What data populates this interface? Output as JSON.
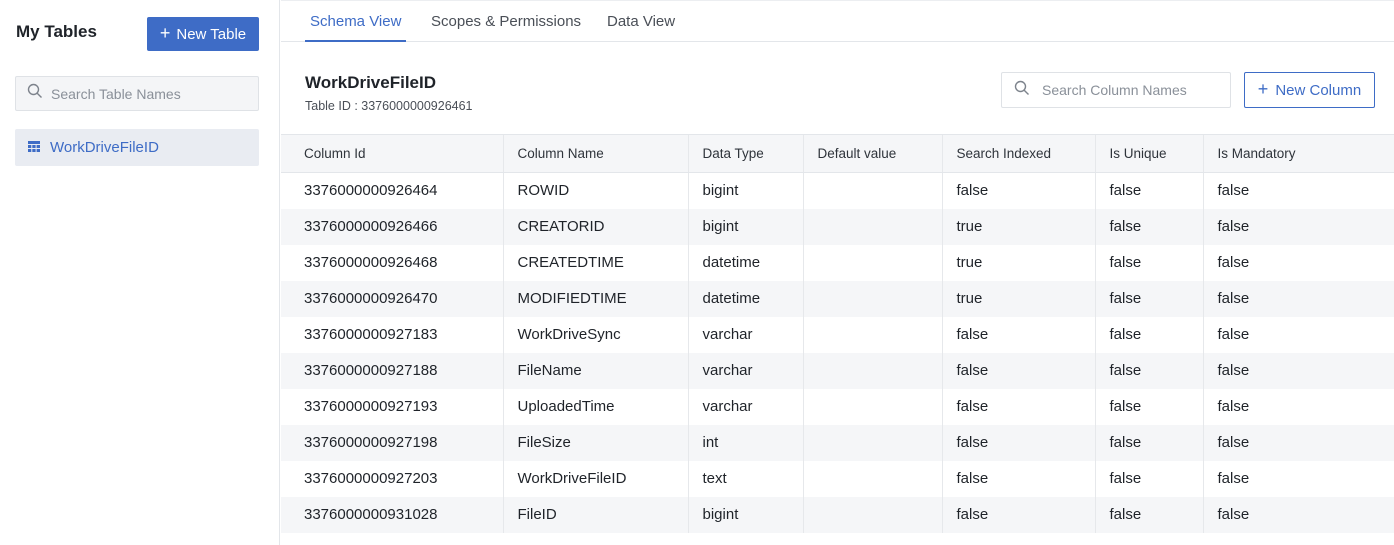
{
  "sidebar": {
    "title": "My Tables",
    "new_table_label": "New Table",
    "search_placeholder": "Search Table Names",
    "items": [
      {
        "label": "WorkDriveFileID",
        "selected": true
      }
    ]
  },
  "tabs": [
    {
      "label": "Schema View",
      "active": true
    },
    {
      "label": "Scopes & Permissions",
      "active": false
    },
    {
      "label": "Data View",
      "active": false
    }
  ],
  "table_header": {
    "name": "WorkDriveFileID",
    "id_text": "Table ID : 3376000000926461",
    "search_placeholder": "Search Column Names",
    "new_column_label": "New Column"
  },
  "columns": [
    "Column Id",
    "Column Name",
    "Data Type",
    "Default value",
    "Search Indexed",
    "Is Unique",
    "Is Mandatory"
  ],
  "rows": [
    [
      "3376000000926464",
      "ROWID",
      "bigint",
      "",
      "false",
      "false",
      "false"
    ],
    [
      "3376000000926466",
      "CREATORID",
      "bigint",
      "",
      "true",
      "false",
      "false"
    ],
    [
      "3376000000926468",
      "CREATEDTIME",
      "datetime",
      "",
      "true",
      "false",
      "false"
    ],
    [
      "3376000000926470",
      "MODIFIEDTIME",
      "datetime",
      "",
      "true",
      "false",
      "false"
    ],
    [
      "3376000000927183",
      "WorkDriveSync",
      "varchar",
      "",
      "false",
      "false",
      "false"
    ],
    [
      "3376000000927188",
      "FileName",
      "varchar",
      "",
      "false",
      "false",
      "false"
    ],
    [
      "3376000000927193",
      "UploadedTime",
      "varchar",
      "",
      "false",
      "false",
      "false"
    ],
    [
      "3376000000927198",
      "FileSize",
      "int",
      "",
      "false",
      "false",
      "false"
    ],
    [
      "3376000000927203",
      "WorkDriveFileID",
      "text",
      "",
      "false",
      "false",
      "false"
    ],
    [
      "3376000000931028",
      "FileID",
      "bigint",
      "",
      "false",
      "false",
      "false"
    ]
  ],
  "colors": {
    "accent": "#3e6cc6",
    "row_alt": "#f5f6f8",
    "border": "#e3e6ea"
  },
  "icons": {
    "search": "search-icon",
    "table": "table-grid-icon",
    "plus": "plus-icon"
  }
}
